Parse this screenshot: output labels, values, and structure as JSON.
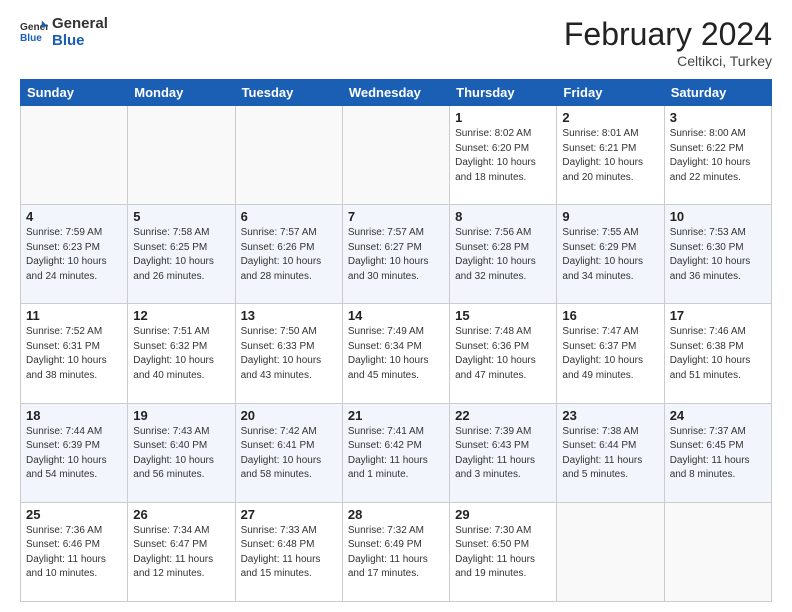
{
  "header": {
    "logo_general": "General",
    "logo_blue": "Blue",
    "month_title": "February 2024",
    "location": "Celtikci, Turkey"
  },
  "days_of_week": [
    "Sunday",
    "Monday",
    "Tuesday",
    "Wednesday",
    "Thursday",
    "Friday",
    "Saturday"
  ],
  "weeks": [
    [
      {
        "day": "",
        "info": ""
      },
      {
        "day": "",
        "info": ""
      },
      {
        "day": "",
        "info": ""
      },
      {
        "day": "",
        "info": ""
      },
      {
        "day": "1",
        "info": "Sunrise: 8:02 AM\nSunset: 6:20 PM\nDaylight: 10 hours\nand 18 minutes."
      },
      {
        "day": "2",
        "info": "Sunrise: 8:01 AM\nSunset: 6:21 PM\nDaylight: 10 hours\nand 20 minutes."
      },
      {
        "day": "3",
        "info": "Sunrise: 8:00 AM\nSunset: 6:22 PM\nDaylight: 10 hours\nand 22 minutes."
      }
    ],
    [
      {
        "day": "4",
        "info": "Sunrise: 7:59 AM\nSunset: 6:23 PM\nDaylight: 10 hours\nand 24 minutes."
      },
      {
        "day": "5",
        "info": "Sunrise: 7:58 AM\nSunset: 6:25 PM\nDaylight: 10 hours\nand 26 minutes."
      },
      {
        "day": "6",
        "info": "Sunrise: 7:57 AM\nSunset: 6:26 PM\nDaylight: 10 hours\nand 28 minutes."
      },
      {
        "day": "7",
        "info": "Sunrise: 7:57 AM\nSunset: 6:27 PM\nDaylight: 10 hours\nand 30 minutes."
      },
      {
        "day": "8",
        "info": "Sunrise: 7:56 AM\nSunset: 6:28 PM\nDaylight: 10 hours\nand 32 minutes."
      },
      {
        "day": "9",
        "info": "Sunrise: 7:55 AM\nSunset: 6:29 PM\nDaylight: 10 hours\nand 34 minutes."
      },
      {
        "day": "10",
        "info": "Sunrise: 7:53 AM\nSunset: 6:30 PM\nDaylight: 10 hours\nand 36 minutes."
      }
    ],
    [
      {
        "day": "11",
        "info": "Sunrise: 7:52 AM\nSunset: 6:31 PM\nDaylight: 10 hours\nand 38 minutes."
      },
      {
        "day": "12",
        "info": "Sunrise: 7:51 AM\nSunset: 6:32 PM\nDaylight: 10 hours\nand 40 minutes."
      },
      {
        "day": "13",
        "info": "Sunrise: 7:50 AM\nSunset: 6:33 PM\nDaylight: 10 hours\nand 43 minutes."
      },
      {
        "day": "14",
        "info": "Sunrise: 7:49 AM\nSunset: 6:34 PM\nDaylight: 10 hours\nand 45 minutes."
      },
      {
        "day": "15",
        "info": "Sunrise: 7:48 AM\nSunset: 6:36 PM\nDaylight: 10 hours\nand 47 minutes."
      },
      {
        "day": "16",
        "info": "Sunrise: 7:47 AM\nSunset: 6:37 PM\nDaylight: 10 hours\nand 49 minutes."
      },
      {
        "day": "17",
        "info": "Sunrise: 7:46 AM\nSunset: 6:38 PM\nDaylight: 10 hours\nand 51 minutes."
      }
    ],
    [
      {
        "day": "18",
        "info": "Sunrise: 7:44 AM\nSunset: 6:39 PM\nDaylight: 10 hours\nand 54 minutes."
      },
      {
        "day": "19",
        "info": "Sunrise: 7:43 AM\nSunset: 6:40 PM\nDaylight: 10 hours\nand 56 minutes."
      },
      {
        "day": "20",
        "info": "Sunrise: 7:42 AM\nSunset: 6:41 PM\nDaylight: 10 hours\nand 58 minutes."
      },
      {
        "day": "21",
        "info": "Sunrise: 7:41 AM\nSunset: 6:42 PM\nDaylight: 11 hours\nand 1 minute."
      },
      {
        "day": "22",
        "info": "Sunrise: 7:39 AM\nSunset: 6:43 PM\nDaylight: 11 hours\nand 3 minutes."
      },
      {
        "day": "23",
        "info": "Sunrise: 7:38 AM\nSunset: 6:44 PM\nDaylight: 11 hours\nand 5 minutes."
      },
      {
        "day": "24",
        "info": "Sunrise: 7:37 AM\nSunset: 6:45 PM\nDaylight: 11 hours\nand 8 minutes."
      }
    ],
    [
      {
        "day": "25",
        "info": "Sunrise: 7:36 AM\nSunset: 6:46 PM\nDaylight: 11 hours\nand 10 minutes."
      },
      {
        "day": "26",
        "info": "Sunrise: 7:34 AM\nSunset: 6:47 PM\nDaylight: 11 hours\nand 12 minutes."
      },
      {
        "day": "27",
        "info": "Sunrise: 7:33 AM\nSunset: 6:48 PM\nDaylight: 11 hours\nand 15 minutes."
      },
      {
        "day": "28",
        "info": "Sunrise: 7:32 AM\nSunset: 6:49 PM\nDaylight: 11 hours\nand 17 minutes."
      },
      {
        "day": "29",
        "info": "Sunrise: 7:30 AM\nSunset: 6:50 PM\nDaylight: 11 hours\nand 19 minutes."
      },
      {
        "day": "",
        "info": ""
      },
      {
        "day": "",
        "info": ""
      }
    ]
  ]
}
